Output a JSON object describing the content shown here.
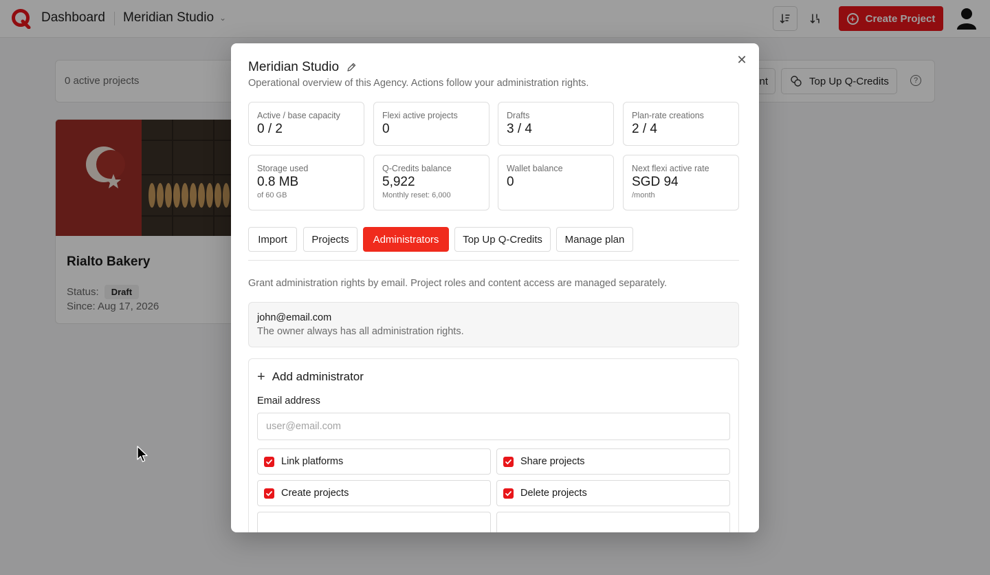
{
  "header": {
    "title": "Dashboard",
    "agency": "Meridian Studio",
    "create_label": "Create Project",
    "icons": [
      "sort-ascending-icon",
      "sort-descending-icon",
      "user-avatar-icon"
    ]
  },
  "dashboard": {
    "active_projects": "0 active projects",
    "partial_button_label": "nt",
    "topup_label": "Top Up Q-Credits",
    "card": {
      "title": "Rialto Bakery",
      "status_label": "Status:",
      "status_value": "Draft",
      "since": "Since: Aug 17, 2026"
    }
  },
  "modal": {
    "title": "Meridian Studio",
    "subtitle": "Operational overview of this Agency. Actions follow your administration rights.",
    "stats": [
      {
        "label": "Active / base capacity",
        "value": "0 / 2",
        "note": ""
      },
      {
        "label": "Flexi active projects",
        "value": "0",
        "note": ""
      },
      {
        "label": "Drafts",
        "value": "3 / 4",
        "note": ""
      },
      {
        "label": "Plan-rate creations",
        "value": "2 / 4",
        "note": ""
      },
      {
        "label": "Storage used",
        "value": "0.8 MB",
        "note": "of 60 GB"
      },
      {
        "label": "Q-Credits balance",
        "value": "5,922",
        "note": "Monthly reset: 6,000"
      },
      {
        "label": "Wallet balance",
        "value": "0",
        "note": ""
      },
      {
        "label": "Next flexi active rate",
        "value": "SGD 94",
        "note": "/month"
      }
    ],
    "tabs": [
      {
        "label": "Import",
        "active": false
      },
      {
        "label": "Projects",
        "active": false
      },
      {
        "label": "Administrators",
        "active": true
      },
      {
        "label": "Top Up Q-Credits",
        "active": false
      },
      {
        "label": "Manage plan",
        "active": false
      }
    ],
    "description": "Grant administration rights by email. Project roles and content access are managed separately.",
    "owner": {
      "email": "john@email.com",
      "note": "The owner always has all administration rights."
    },
    "add_admin": {
      "heading": "Add administrator",
      "email_label": "Email address",
      "email_placeholder": "user@email.com",
      "email_value": "",
      "permissions": [
        {
          "label": "Link platforms",
          "checked": true
        },
        {
          "label": "Share projects",
          "checked": true
        },
        {
          "label": "Create projects",
          "checked": true
        },
        {
          "label": "Delete projects",
          "checked": true
        }
      ]
    }
  },
  "colors": {
    "accent": "#e8161a",
    "tab_active": "#f02b1d",
    "overlay": "rgba(0,0,0,0.38)"
  }
}
